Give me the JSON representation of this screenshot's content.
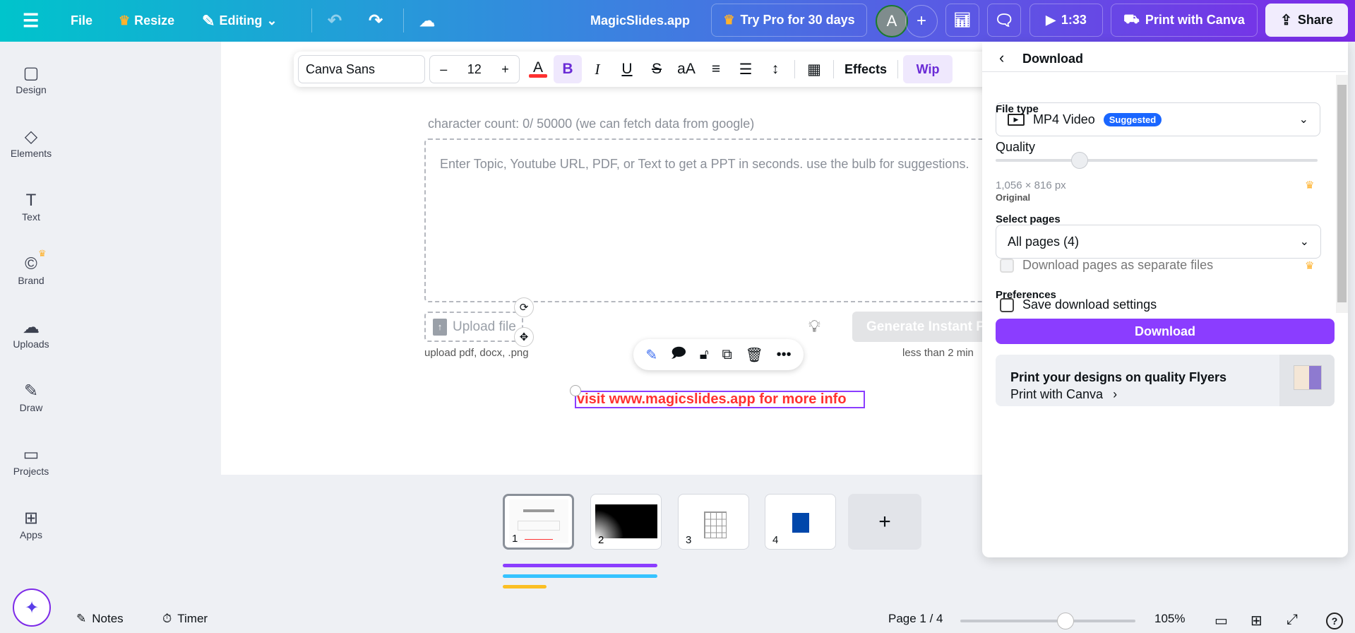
{
  "topbar": {
    "file": "File",
    "resize": "Resize",
    "editing": "Editing",
    "title": "MagicSlides.app",
    "try_pro": "Try Pro for 30 days",
    "avatar": "A",
    "play_time": "1:33",
    "print": "Print with Canva",
    "share": "Share"
  },
  "sidebar": {
    "items": [
      {
        "label": "Design",
        "icon": "▢"
      },
      {
        "label": "Elements",
        "icon": "◇"
      },
      {
        "label": "Text",
        "icon": "T"
      },
      {
        "label": "Brand",
        "icon": "©"
      },
      {
        "label": "Uploads",
        "icon": "☁"
      },
      {
        "label": "Draw",
        "icon": "✎"
      },
      {
        "label": "Projects",
        "icon": "▭"
      },
      {
        "label": "Apps",
        "icon": "⊞"
      }
    ]
  },
  "format_toolbar": {
    "font": "Canva Sans",
    "size": "12",
    "effects": "Effects",
    "wip": "Wip"
  },
  "slide": {
    "char_count": "character count: 0/ 50000 (we can fetch data from google)",
    "placeholder": "Enter Topic, Youtube URL, PDF, or Text to get a PPT in seconds. use the bulb for suggestions.",
    "upload": "Upload file",
    "upload_hint": "upload pdf, docx, .png",
    "generate": "Generate Instant PPT",
    "time_hint": "less than 2 min",
    "link_text": "visit www.magicslides.app for more info"
  },
  "panel": {
    "title": "Download",
    "file_type_label": "File type",
    "file_type": "MP4 Video",
    "badge": "Suggested",
    "quality_label": "Quality",
    "quality_value": 0.26,
    "dimensions": "1,056 × 816 px",
    "original": "Original",
    "select_pages_label": "Select pages",
    "pages": "All pages (4)",
    "separate_files": "Download pages as separate files",
    "preferences": "Preferences",
    "save_settings": "Save download settings",
    "download_btn": "Download",
    "promo_title": "Print your designs on quality Flyers",
    "promo_link": "Print with Canva"
  },
  "pages": {
    "thumbs": [
      "1",
      "2",
      "3",
      "4"
    ],
    "add": "+"
  },
  "bottombar": {
    "notes": "Notes",
    "timer": "Timer",
    "page": "Page 1 / 4",
    "zoom": "105%",
    "zoom_value": 0.6
  },
  "colors": {
    "accent": "#8b3dff",
    "badge": "#1a66ff",
    "link_red": "#ff3131"
  }
}
